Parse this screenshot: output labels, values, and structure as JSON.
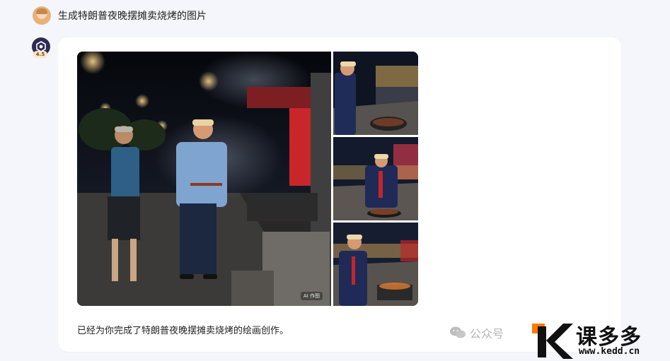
{
  "user": {
    "message": "生成特朗普夜晚摆摊卖烧烤的图片",
    "avatar_icon": "user-avatar-icon"
  },
  "assistant": {
    "model_badge": "4.5",
    "avatar_icon": "assistant-logo-icon",
    "reply": "已经为你完成了特朗普夜晚摆摊卖烧烤的绘画创作。",
    "ai_label": "AI 作图",
    "images": [
      "main-image",
      "thumbnail-1",
      "thumbnail-2",
      "thumbnail-3"
    ]
  },
  "watermark": {
    "wechat_label": "公众号",
    "brand": "课多多",
    "url": "www.kedd.cn",
    "accent": "#ff7a00"
  }
}
